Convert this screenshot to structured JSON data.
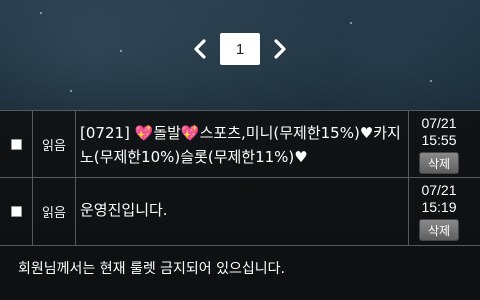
{
  "pagination": {
    "current_page": "1"
  },
  "rows": [
    {
      "status": "읽음",
      "title": "[0721] 💖돌발💖스포츠,미니(무제한15%)♥카지노(무제한10%)슬롯(무제한11%)♥",
      "date": "07/21",
      "time": "15:55",
      "delete_label": "삭제"
    },
    {
      "status": "읽음",
      "title": "운영진입니다.",
      "date": "07/21",
      "time": "15:19",
      "delete_label": "삭제"
    }
  ],
  "notice": "회원님께서는 현재 룰렛 금지되어 있으십니다."
}
